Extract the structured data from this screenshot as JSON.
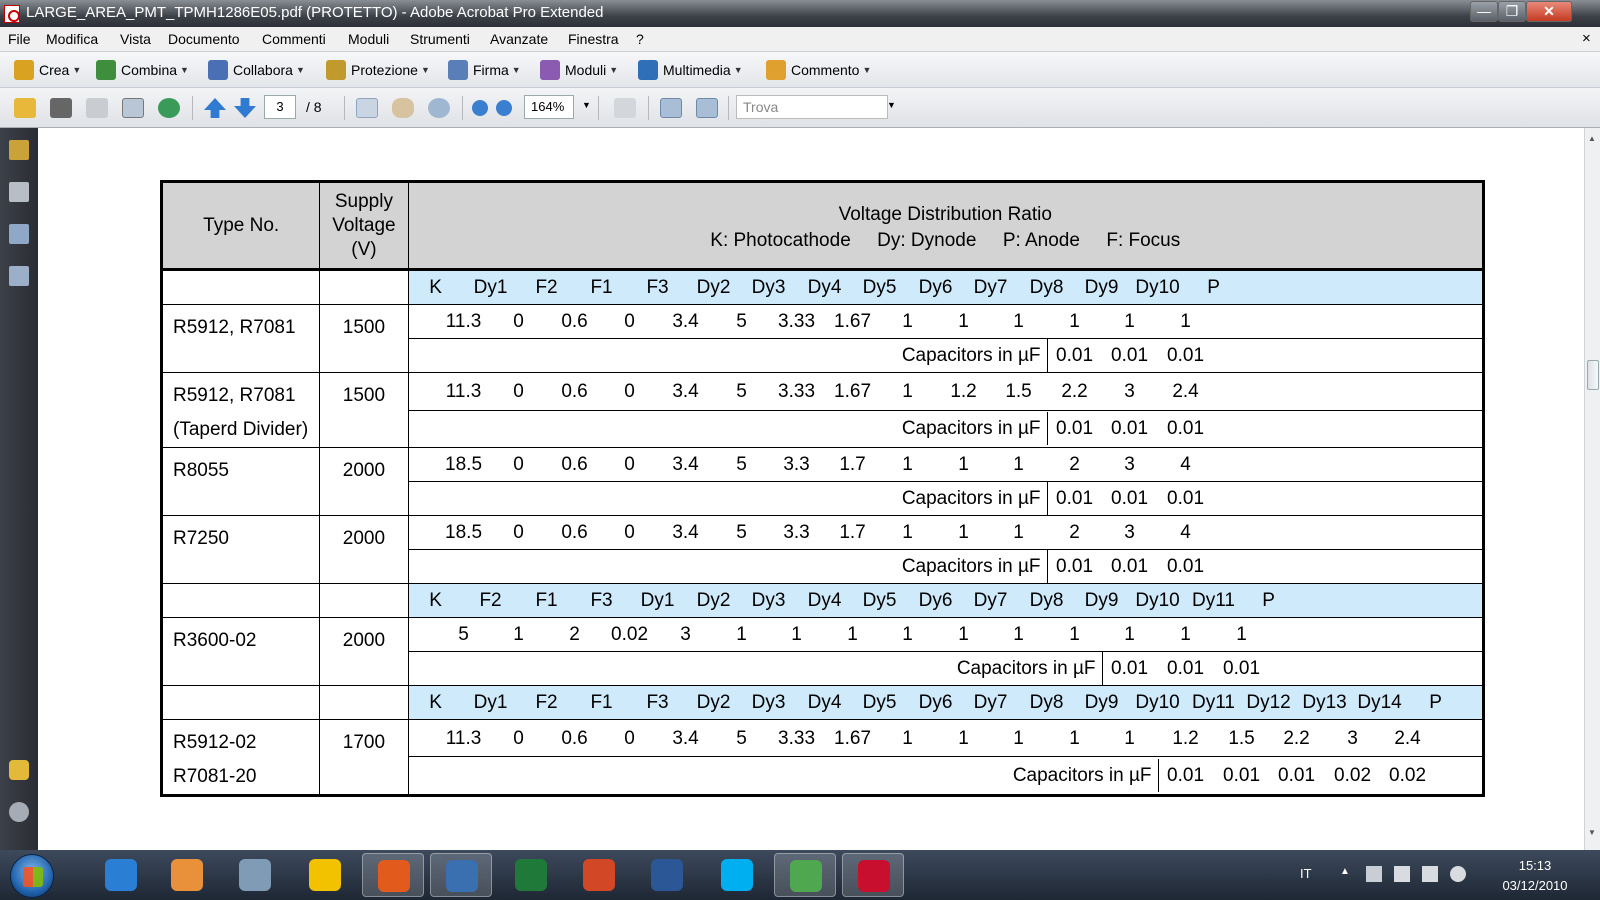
{
  "window": {
    "title": "LARGE_AREA_PMT_TPMH1286E05.pdf (PROTETTO) - Adobe Acrobat Pro Extended",
    "minimize": "—",
    "maximize": "❐",
    "close": "✕"
  },
  "menubar": {
    "items": [
      "File",
      "Modifica",
      "Vista",
      "Documento",
      "Commenti",
      "Moduli",
      "Strumenti",
      "Avanzate",
      "Finestra",
      "?"
    ],
    "close": "×"
  },
  "tasks": [
    {
      "label": "Crea",
      "icon": "create-icon",
      "color": "#d9a321"
    },
    {
      "label": "Combina",
      "icon": "combine-icon",
      "color": "#3e8e3e"
    },
    {
      "label": "Collabora",
      "icon": "collaborate-icon",
      "color": "#4b6fb5"
    },
    {
      "label": "Protezione",
      "icon": "lock-icon",
      "color": "#c19a2e"
    },
    {
      "label": "Firma",
      "icon": "pen-icon",
      "color": "#5a7fb8"
    },
    {
      "label": "Moduli",
      "icon": "form-icon",
      "color": "#8a5bb0"
    },
    {
      "label": "Multimedia",
      "icon": "multimedia-icon",
      "color": "#2f6fb7"
    },
    {
      "label": "Commento",
      "icon": "comment-icon",
      "color": "#e0a030"
    }
  ],
  "toolbar": {
    "page_current": "3",
    "page_total": "/ 8",
    "zoom": "164%",
    "find_placeholder": "Trova"
  },
  "table": {
    "header": {
      "type_no": "Type No.",
      "supply_voltage": "Supply Voltage (V)",
      "vdr_title": "Voltage Distribution Ratio",
      "vdr_legend": "K: Photocathode     Dy: Dynode     P: Anode     F: Focus"
    },
    "capacitor_label": "Capacitors in µF",
    "header_row_a": [
      "K",
      "Dy1",
      "F2",
      "F1",
      "F3",
      "Dy2",
      "Dy3",
      "Dy4",
      "Dy5",
      "Dy6",
      "Dy7",
      "Dy8",
      "Dy9",
      "Dy10",
      "P"
    ],
    "header_row_b": [
      "K",
      "F2",
      "F1",
      "F3",
      "Dy1",
      "Dy2",
      "Dy3",
      "Dy4",
      "Dy5",
      "Dy6",
      "Dy7",
      "Dy8",
      "Dy9",
      "Dy10",
      "Dy11",
      "P"
    ],
    "header_row_c": [
      "K",
      "Dy1",
      "F2",
      "F1",
      "F3",
      "Dy2",
      "Dy3",
      "Dy4",
      "Dy5",
      "Dy6",
      "Dy7",
      "Dy8",
      "Dy9",
      "Dy10",
      "Dy11",
      "Dy12",
      "Dy13",
      "Dy14",
      "P"
    ],
    "rows": [
      {
        "type": "R5912, R7081",
        "type2": "",
        "voltage": "1500",
        "ratios": [
          "11.3",
          "0",
          "0.6",
          "0",
          "3.4",
          "5",
          "3.33",
          "1.67",
          "1",
          "1",
          "1",
          "1",
          "1",
          "1"
        ],
        "caps": [
          "0.01",
          "0.01",
          "0.01"
        ]
      },
      {
        "type": "R5912, R7081",
        "type2": "(Taperd Divider)",
        "voltage": "1500",
        "ratios": [
          "11.3",
          "0",
          "0.6",
          "0",
          "3.4",
          "5",
          "3.33",
          "1.67",
          "1",
          "1.2",
          "1.5",
          "2.2",
          "3",
          "2.4"
        ],
        "caps": [
          "0.01",
          "0.01",
          "0.01"
        ]
      },
      {
        "type": "R8055",
        "type2": "",
        "voltage": "2000",
        "ratios": [
          "18.5",
          "0",
          "0.6",
          "0",
          "3.4",
          "5",
          "3.3",
          "1.7",
          "1",
          "1",
          "1",
          "2",
          "3",
          "4"
        ],
        "caps": [
          "0.01",
          "0.01",
          "0.01"
        ]
      },
      {
        "type": "R7250",
        "type2": "",
        "voltage": "2000",
        "ratios": [
          "18.5",
          "0",
          "0.6",
          "0",
          "3.4",
          "5",
          "3.3",
          "1.7",
          "1",
          "1",
          "1",
          "2",
          "3",
          "4"
        ],
        "caps": [
          "0.01",
          "0.01",
          "0.01"
        ]
      },
      {
        "type": "R3600-02",
        "type2": "",
        "voltage": "2000",
        "ratios": [
          "5",
          "1",
          "2",
          "0.02",
          "3",
          "1",
          "1",
          "1",
          "1",
          "1",
          "1",
          "1",
          "1",
          "1",
          "1"
        ],
        "caps": [
          "0.01",
          "0.01",
          "0.01"
        ]
      },
      {
        "type": "R5912-02",
        "type2": "R7081-20",
        "voltage": "1700",
        "ratios": [
          "11.3",
          "0",
          "0.6",
          "0",
          "3.4",
          "5",
          "3.33",
          "1.67",
          "1",
          "1",
          "1",
          "1",
          "1",
          "1.2",
          "1.5",
          "2.2",
          "3",
          "2.4"
        ],
        "caps": [
          "0.01",
          "0.01",
          "0.01",
          "0.02",
          "0.02"
        ]
      }
    ]
  },
  "taskbar": {
    "apps": [
      {
        "name": "ie-icon",
        "color": "#2a7fd4"
      },
      {
        "name": "media-player-icon",
        "color": "#e8903a"
      },
      {
        "name": "network-icon",
        "color": "#7f9bb5"
      },
      {
        "name": "updater-icon",
        "color": "#f2c200"
      },
      {
        "name": "firefox-icon",
        "color": "#e25b1c"
      },
      {
        "name": "thunderbird-icon",
        "color": "#3a6fb0"
      },
      {
        "name": "excel-icon",
        "color": "#1f7a3a"
      },
      {
        "name": "powerpoint-icon",
        "color": "#d24726"
      },
      {
        "name": "word-icon",
        "color": "#2b5797"
      },
      {
        "name": "skype-icon",
        "color": "#00aff0"
      },
      {
        "name": "messenger-icon",
        "color": "#4fa84f"
      },
      {
        "name": "acrobat-icon",
        "color": "#c8102e"
      }
    ],
    "lang": "IT",
    "time": "15:13",
    "date": "03/12/2010"
  }
}
